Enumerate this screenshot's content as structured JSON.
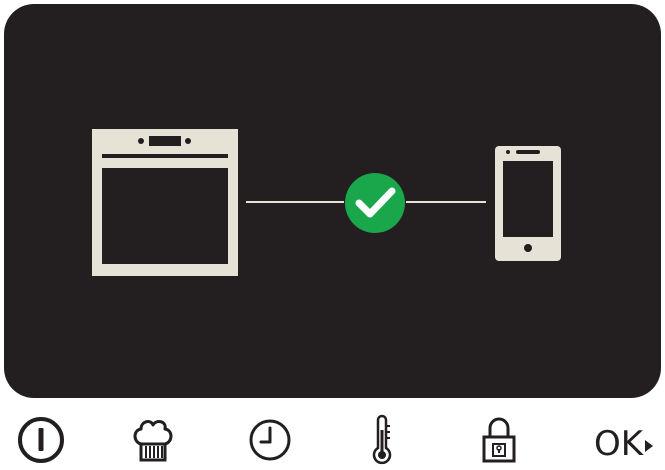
{
  "colors": {
    "screen_background": "#231f20",
    "icon_light": "#e7e2d6",
    "success_green": "#1aa64a",
    "check_white": "#ffffff",
    "control_icon": "#231f20"
  },
  "screen": {
    "status": "connected",
    "left_device_icon": "oven-icon",
    "right_device_icon": "smartphone-icon",
    "status_icon": "check-circle-icon"
  },
  "controls": {
    "items": [
      {
        "icon": "power-icon"
      },
      {
        "icon": "chef-hat-icon"
      },
      {
        "icon": "clock-icon"
      },
      {
        "icon": "thermometer-icon"
      },
      {
        "icon": "lock-icon"
      }
    ],
    "ok_label": "OK"
  }
}
